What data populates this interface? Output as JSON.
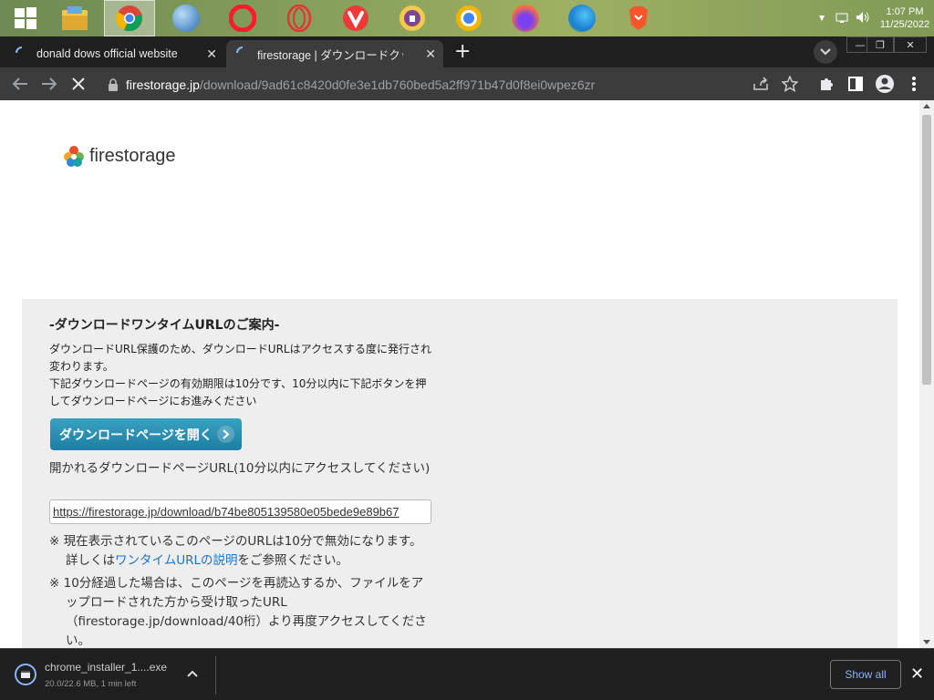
{
  "taskbar": {
    "apps": [
      "start-icon",
      "file-explorer-icon",
      "chrome-icon",
      "world-browser-icon",
      "opera-icon",
      "opera-gx-icon",
      "vivaldi-icon",
      "tor-icon",
      "chrome-canary-icon",
      "firefox-icon",
      "edge-icon",
      "brave-icon"
    ],
    "clock_time": "1:07 PM",
    "clock_date": "11/25/2022",
    "tray_chevron": "▲"
  },
  "tabs": [
    {
      "label": "donald dows official website",
      "close": "✕"
    },
    {
      "label": "firestorage | ダウンロードクッションページ",
      "close": "✕"
    }
  ],
  "new_tab": "+",
  "tab_menu": "⌄",
  "window_controls": {
    "minimize": "—",
    "maximize": "❐",
    "close": "✕"
  },
  "address": {
    "host": "firestorage.jp",
    "path": "/download/9ad61c8420d0fe3e1db760bed5a2ff971b47d0f8ei0wpez6zr"
  },
  "page": {
    "logo_text": "firestorage",
    "title": "-ダウンロードワンタイムURLのご案内-",
    "desc_1": "ダウンロードURL保護のため、ダウンロードURLはアクセスする度に発行され変わります。",
    "desc_2": "下記ダウンロードページの有効期限は10分です、10分以内に下記ボタンを押してダウンロードページにお進みください",
    "button_label": "ダウンロードページを開く",
    "url_label": "開かれるダウンロードページURL(10分以内にアクセスしてください)",
    "url_value": "https://firestorage.jp/download/b74be805139580e05bede9e89b67",
    "note1_prefix": "※ 現在表示されているこのページのURLは10分で無効になります。詳しくは",
    "note1_link": "ワンタイムURLの説明",
    "note1_suffix": "をご参照ください。",
    "note2": "※ 10分経過した場合は、このページを再読込するか、ファイルをアップロードされた方から受け取ったURL（firestorage.jp/download/40桁）より再度アクセスしてください。"
  },
  "downloads": {
    "file_name": "chrome_installer_1....exe",
    "status": "20.0/22.6 MB, 1 min left",
    "show_all": "Show all",
    "close": "✕"
  }
}
